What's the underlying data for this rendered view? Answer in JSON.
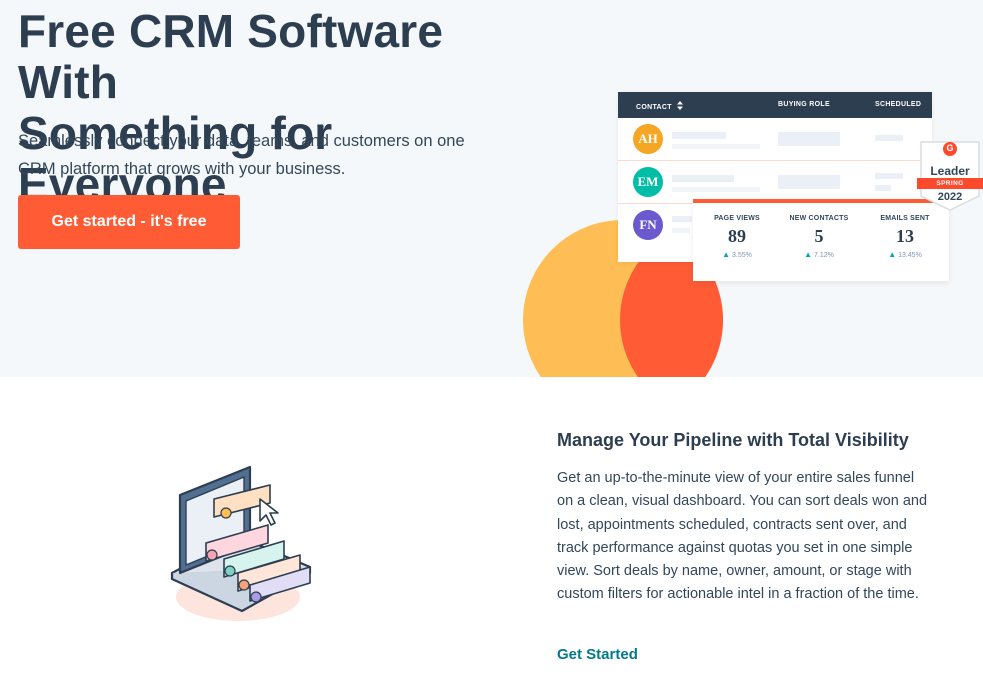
{
  "hero": {
    "title_line1": "Free CRM Software With",
    "title_line2": "Something for Everyone",
    "subtitle": "Seamlessly connect your data, teams, and customers on one CRM platform that grows with your business.",
    "cta_label": "Get started - it's free"
  },
  "crm_table": {
    "columns": [
      "CONTACT",
      "BUYING ROLE",
      "SCHEDULED"
    ],
    "sort_icon": "sort-arrows-icon",
    "rows": [
      {
        "initials": "AH",
        "color": "#f5a623"
      },
      {
        "initials": "EM",
        "color": "#00bda5"
      },
      {
        "initials": "FN",
        "color": "#6a5acd"
      }
    ]
  },
  "stats": [
    {
      "label": "PAGE VIEWS",
      "value": "89",
      "change": "3.55%"
    },
    {
      "label": "NEW CONTACTS",
      "value": "5",
      "change": "7.12%"
    },
    {
      "label": "EMAILS SENT",
      "value": "13",
      "change": "13.45%"
    }
  ],
  "badge": {
    "logo": "G",
    "title": "Leader",
    "season": "SPRING",
    "year": "2022"
  },
  "feature": {
    "title": "Manage Your Pipeline with Total Visibility",
    "body": "Get an up-to-the-minute view of your entire sales funnel on a clean, visual dashboard. You can sort deals won and lost, appointments scheduled, contracts sent over, and track performance against quotas you set in one simple view. Sort deals by name, owner, amount, or stage with custom filters for actionable intel in a fraction of the time.",
    "link_label": "Get Started"
  },
  "colors": {
    "accent_orange": "#ff5c35",
    "accent_yellow": "#ffbe55",
    "navy": "#2d3e50",
    "link_teal": "#007a8c"
  }
}
